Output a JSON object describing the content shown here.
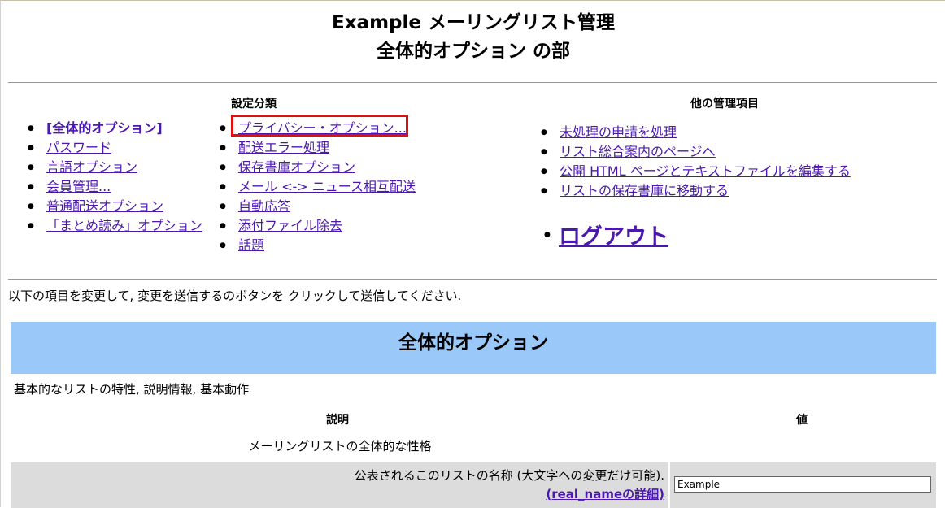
{
  "header": {
    "title_line1": "Example メーリングリスト管理",
    "title_line2": "全体的オプション の部"
  },
  "categories": {
    "heading": "設定分類",
    "col1": [
      {
        "label": "[全体的オプション]",
        "current": true
      },
      {
        "label": "パスワード"
      },
      {
        "label": "言語オプション"
      },
      {
        "label": "会員管理..."
      },
      {
        "label": "普通配送オプション"
      },
      {
        "label": "「まとめ読み」オプション"
      }
    ],
    "col2": [
      {
        "label": "プライバシー・オプション..."
      },
      {
        "label": "配送エラー処理"
      },
      {
        "label": "保存書庫オプション"
      },
      {
        "label": "メール <-> ニュース相互配送"
      },
      {
        "label": "自動応答"
      },
      {
        "label": "添付ファイル除去"
      },
      {
        "label": "話題"
      }
    ]
  },
  "other_admin": {
    "heading": "他の管理項目",
    "items": [
      {
        "label": "未処理の申請を処理"
      },
      {
        "label": "リスト総合案内のページへ"
      },
      {
        "label": "公開 HTML ページとテキストファイルを編集する"
      },
      {
        "label": "リストの保存書庫に移動する"
      }
    ],
    "logout": "ログアウト"
  },
  "instructions": "以下の項目を変更して, 変更を送信するのボタンを クリックして送信してください.",
  "section": {
    "title": "全体的オプション",
    "description": "基本的なリストの特性, 説明情報, 基本動作",
    "col_description": "説明",
    "col_value": "値",
    "subheading": "メーリングリストの全体的な性格",
    "rows": [
      {
        "label": "公表されるこのリストの名称 (大文字への変更だけ可能).",
        "detail_link": "(real_nameの詳細)",
        "value": "Example"
      }
    ]
  },
  "colors": {
    "link": "#4a18ad",
    "banner": "#99c8f9",
    "row_bg": "#dcdcdc",
    "highlight": "#e01010"
  }
}
